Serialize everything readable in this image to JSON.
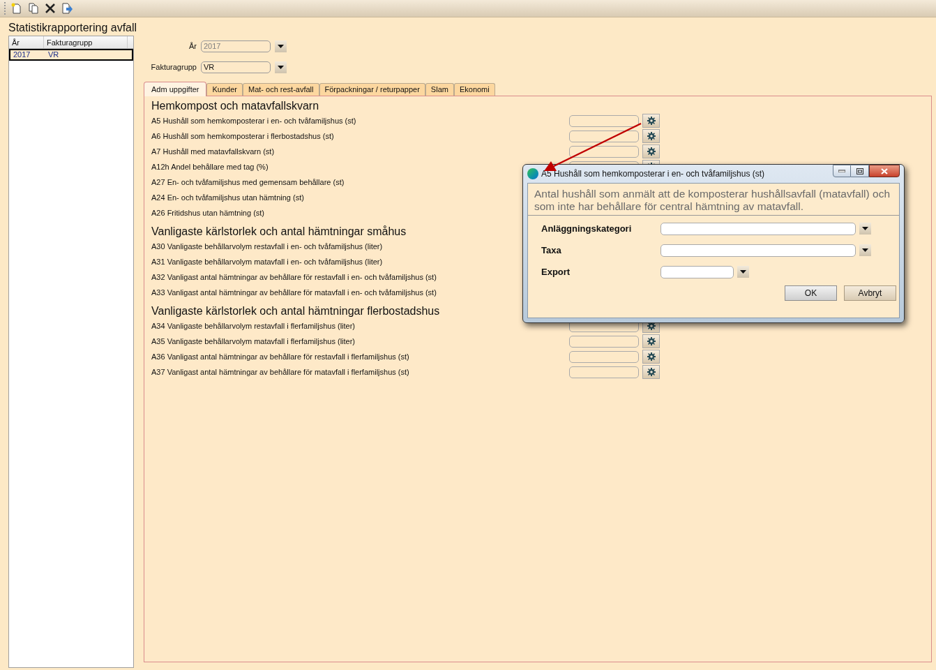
{
  "toolbar": {
    "buttons": [
      {
        "kind": "new"
      },
      {
        "kind": "copy"
      },
      {
        "kind": "delete"
      },
      {
        "kind": "export"
      }
    ]
  },
  "title": "Statistikrapportering avfall",
  "list": {
    "columns": [
      "År",
      "Fakturagrupp"
    ],
    "rows": [
      {
        "cells": [
          "2017",
          "VR"
        ],
        "selected": true
      }
    ]
  },
  "filters": [
    {
      "label": "År",
      "value": "2017",
      "disabled": true
    },
    {
      "label": "Fakturagrupp",
      "value": "VR",
      "disabled": false
    }
  ],
  "tabs": [
    {
      "label": "Adm uppgifter",
      "selected": true
    },
    {
      "label": "Kunder",
      "selected": false
    },
    {
      "label": "Mat- och rest-avfall",
      "selected": false
    },
    {
      "label": "Förpackningar / returpapper",
      "selected": false
    },
    {
      "label": "Slam",
      "selected": false
    },
    {
      "label": "Ekonomi",
      "selected": false
    }
  ],
  "sections": [
    {
      "heading": "Hemkompost och matavfallskvarn",
      "rows": [
        "A5 Hushåll som hemkomposterar i en- och tvåfamiljshus (st)",
        "A6 Hushåll som hemkomposterar i flerbostadshus (st)",
        "A7 Hushåll med matavfallskvarn (st)",
        "A12h Andel behållare med tag (%)",
        "A27 En- och tvåfamiljshus med gemensam behållare (st)",
        "A24 En- och tvåfamiljshus utan hämtning (st)",
        "A26 Fritidshus utan hämtning (st)"
      ]
    },
    {
      "heading": "Vanligaste kärlstorlek och antal hämtningar småhus",
      "rows": [
        "A30 Vanligaste behållarvolym restavfall i en- och tvåfamiljshus (liter)",
        "A31 Vanligaste behållarvolym matavfall i en- och tvåfamiljshus (liter)",
        "A32 Vanligast antal hämtningar av behållare för restavfall i en- och tvåfamiljshus (st)",
        "A33 Vanligast antal hämtningar av behållare för matavfall i en- och tvåfamiljshus (st)"
      ]
    },
    {
      "heading": "Vanligaste kärlstorlek och antal hämtningar flerbostadshus",
      "rows": [
        "A34 Vanligaste behållarvolym restavfall i flerfamiljshus (liter)",
        "A35 Vanligaste behållarvolym matavfall i flerfamiljshus (liter)",
        "A36 Vanligast antal hämtningar av behållare för restavfall i flerfamiljshus (st)",
        "A37 Vanligast antal hämtningar av behållare för matavfall i flerfamiljshus (st)"
      ]
    }
  ],
  "dialog": {
    "title": "A5 Hushåll som hemkomposterar i en- och tvåfamiljshus (st)",
    "description": "Antal hushåll som anmält att de komposterar hushållsavfall (matavfall) och som inte har behållare för central hämtning av matavfall.",
    "fields": [
      {
        "label": "Anläggningskategori",
        "wide": true
      },
      {
        "label": "Taxa",
        "wide": true
      },
      {
        "label": "Export",
        "wide": false
      }
    ],
    "buttons": [
      {
        "label": "OK",
        "kind": "primary"
      },
      {
        "label": "Avbryt",
        "kind": "secondary"
      }
    ]
  }
}
